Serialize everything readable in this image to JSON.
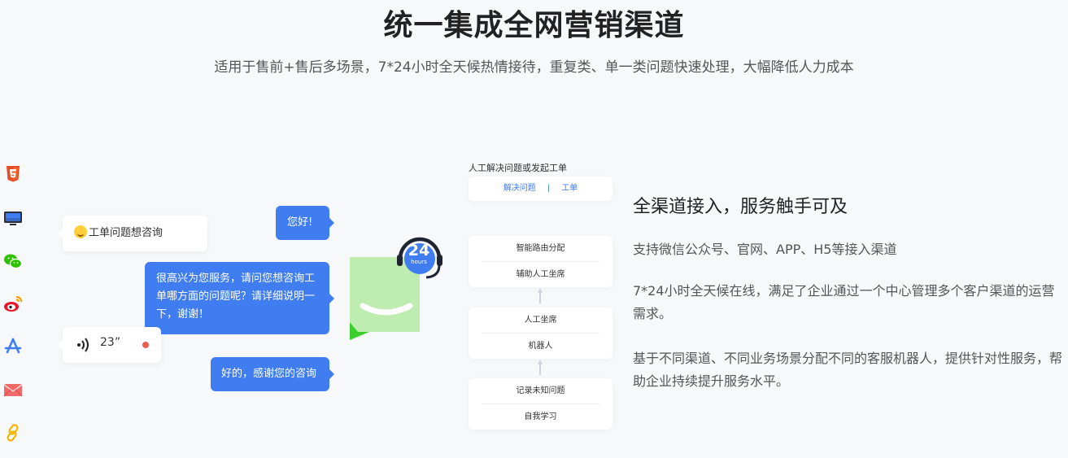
{
  "header": {
    "title": "统一集成全网营销渠道",
    "subtitle": "适用于售前+售后多场景，7*24小时全天候热情接待，重复类、单一类问题快速处理，大幅降低人力成本"
  },
  "channels": [
    {
      "icon": "html5-icon"
    },
    {
      "icon": "monitor-icon"
    },
    {
      "icon": "wechat-icon"
    },
    {
      "icon": "weibo-icon"
    },
    {
      "icon": "app-store-icon"
    },
    {
      "icon": "mail-icon"
    },
    {
      "icon": "link-icon"
    }
  ],
  "chat": {
    "msg1": "您好!",
    "msg2": "工单问题想咨询",
    "msg3": "很高兴为您服务，请问您想咨询工单哪方面的问题呢？请详细说明一下，谢谢！",
    "voice_duration": "23”",
    "msg4": "好的，感谢您的咨询"
  },
  "badge": {
    "big": "24",
    "small": "hours"
  },
  "flow": {
    "heading": "人工解决问题或发起工单",
    "tab1": "解决问题",
    "tab_sep": "|",
    "tab2": "工单",
    "box1": [
      "智能路由分配",
      "辅助人工坐席"
    ],
    "box2": [
      "人工坐席",
      "机器人"
    ],
    "box3": [
      "记录未知问题",
      "自我学习"
    ]
  },
  "feature": {
    "title": "全渠道接入，服务触手可及",
    "p1": "支持微信公众号、官网、APP、H5等接入渠道",
    "p2": "7*24小时全天候在线，满足了企业通过一个中心管理多个客户渠道的运营需求。",
    "p3": "基于不同渠道、不同业务场景分配不同的客服机器人，提供针对性服务，帮助企业持续提升服务水平。"
  },
  "colors": {
    "accent": "#3f7df0",
    "green": "#7ad06a"
  }
}
